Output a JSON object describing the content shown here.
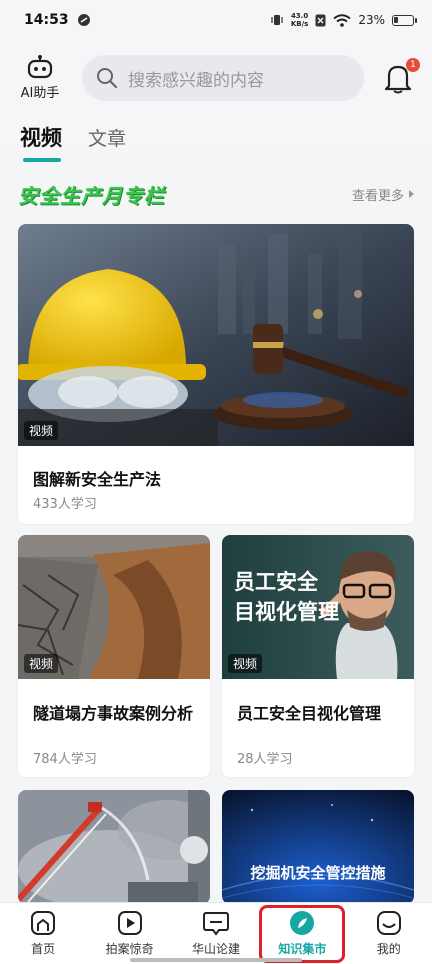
{
  "status": {
    "time": "14:53",
    "net_speed_value": "43.0",
    "net_speed_unit": "KB/s",
    "battery": "23%"
  },
  "header": {
    "ai_label": "AI助手",
    "search_placeholder": "搜索感兴趣的内容",
    "notification_count": "1"
  },
  "tabs": [
    {
      "label": "视频",
      "active": true
    },
    {
      "label": "文章",
      "active": false
    }
  ],
  "section": {
    "title": "安全生产月专栏",
    "more_label": "查看更多"
  },
  "cards": [
    {
      "tag": "视频",
      "title": "图解新安全生产法",
      "learners": "433人学习"
    },
    {
      "tag": "视频",
      "title": "隧道塌方事故案例分析",
      "learners": "784人学习"
    },
    {
      "tag": "视频",
      "title": "员工安全目视化管理",
      "learners": "28人学习",
      "thumb_text_1": "员工安全",
      "thumb_text_2": "目视化管理"
    },
    {
      "thumb_text": ""
    },
    {
      "thumb_text": "挖掘机安全管控措施"
    }
  ],
  "bottom_nav": [
    {
      "label": "首页",
      "icon": "home-icon"
    },
    {
      "label": "拍案惊奇",
      "icon": "video-icon"
    },
    {
      "label": "华山论建",
      "icon": "chat-icon"
    },
    {
      "label": "知识集市",
      "icon": "compass-icon",
      "active": true
    },
    {
      "label": "我的",
      "icon": "profile-icon"
    }
  ],
  "colors": {
    "accent": "#17a7a3",
    "badge": "#e64c3c",
    "section_title": "#3cc24e",
    "highlight_box": "#d8232a"
  }
}
